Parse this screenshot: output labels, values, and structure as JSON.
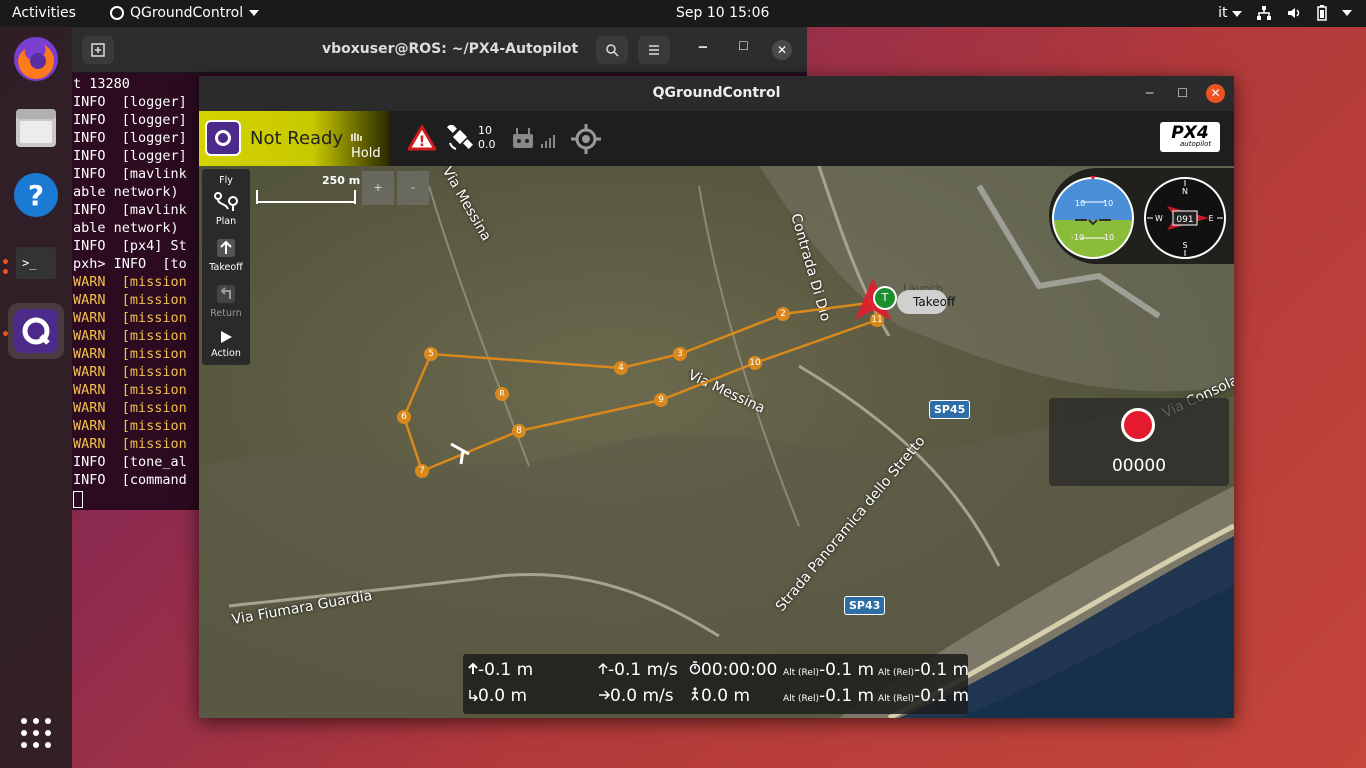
{
  "topbar": {
    "activities": "Activities",
    "app_name": "QGroundControl",
    "clock": "Sep 10  15:06",
    "lang": "it"
  },
  "terminal": {
    "title": "vboxuser@ROS: ~/PX4-Autopilot",
    "lines": [
      {
        "text": "t 13280",
        "type": "info"
      },
      {
        "text": "INFO  [logger]",
        "type": "info"
      },
      {
        "text": "INFO  [logger]",
        "type": "info"
      },
      {
        "text": "INFO  [logger]",
        "type": "info"
      },
      {
        "text": "INFO  [logger]",
        "type": "info"
      },
      {
        "text": "INFO  [mavlink",
        "type": "info"
      },
      {
        "text": "able network)",
        "type": "info"
      },
      {
        "text": "INFO  [mavlink",
        "type": "info"
      },
      {
        "text": "able network)",
        "type": "info"
      },
      {
        "text": "INFO  [px4] St",
        "type": "info"
      },
      {
        "text": "pxh> INFO  [to",
        "type": "info"
      },
      {
        "text": "WARN  [mission",
        "type": "warn"
      },
      {
        "text": "WARN  [mission",
        "type": "warn"
      },
      {
        "text": "WARN  [mission",
        "type": "warn"
      },
      {
        "text": "WARN  [mission",
        "type": "warn"
      },
      {
        "text": "WARN  [mission",
        "type": "warn"
      },
      {
        "text": "WARN  [mission",
        "type": "warn"
      },
      {
        "text": "WARN  [mission",
        "type": "warn"
      },
      {
        "text": "WARN  [mission",
        "type": "warn"
      },
      {
        "text": "WARN  [mission",
        "type": "warn"
      },
      {
        "text": "WARN  [mission",
        "type": "warn"
      },
      {
        "text": "INFO  [tone_al",
        "type": "info"
      },
      {
        "text": "INFO  [command",
        "type": "info"
      }
    ]
  },
  "qgc": {
    "title": "QGroundControl",
    "status": "Not Ready",
    "flight_mode": "Hold",
    "gps_count": "10",
    "gps_hdop": "0.0",
    "logo_text": "PX4",
    "logo_sub": "autopilot",
    "tools": [
      {
        "label": "Fly",
        "icon": "fly-icon"
      },
      {
        "label": "Plan",
        "icon": "plan-icon"
      },
      {
        "label": "Takeoff",
        "icon": "takeoff-icon"
      },
      {
        "label": "Return",
        "icon": "return-icon"
      },
      {
        "label": "Action",
        "icon": "action-icon"
      }
    ],
    "scale_label": "250 m",
    "zoom_in": "+",
    "zoom_out": "-",
    "takeoff_marker": "T",
    "takeoff_label": "Takeoff",
    "launch_label": "Launch",
    "rally_label": "R",
    "waypoints": [
      "2",
      "3",
      "4",
      "5",
      "6",
      "7",
      "8",
      "9",
      "10",
      "11"
    ],
    "roads": [
      "Via Messina",
      "Via Messina",
      "Contrada Di Dio",
      "Strada Panoramica dello Stretto",
      "Via Fiumara Guardia",
      "Via Consolare"
    ],
    "badges": [
      "SP45",
      "SP43"
    ],
    "attitude": {
      "top_left": "10",
      "top_right": "10",
      "bottom_left": "-10",
      "bottom_right": "-10"
    },
    "compass": {
      "n": "N",
      "e": "E",
      "s": "S",
      "w": "W",
      "heading": "091"
    },
    "recording_count": "00000",
    "telemetry": {
      "alt": "-0.1 m",
      "dist": "0.0 m",
      "vspeed": "-0.1 m/s",
      "hspeed": "0.0 m/s",
      "time": "00:00:00",
      "home_dist": "0.0 m",
      "alt_rel_label": "Alt (Rel)",
      "alt_rel_1": "-0.1 m",
      "alt_rel_2": "-0.1 m",
      "alt_rel_3": "-0.1 m",
      "alt_rel_4": "-0.1 m"
    }
  }
}
